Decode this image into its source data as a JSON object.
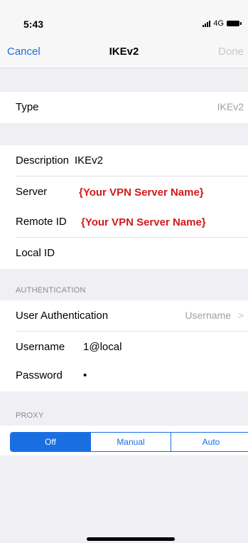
{
  "status": {
    "time": "5:43",
    "network": "4G"
  },
  "nav": {
    "cancel": "Cancel",
    "title": "IKEv2",
    "done": "Done"
  },
  "type_row": {
    "label": "Type",
    "value": "IKEv2"
  },
  "fields": {
    "description": {
      "label": "Description",
      "value": "IKEv2"
    },
    "server": {
      "label": "Server",
      "value": "{Your VPN Server Name}"
    },
    "remote_id": {
      "label": "Remote ID",
      "value": "{Your VPN Server Name}"
    },
    "local_id": {
      "label": "Local ID",
      "value": ""
    }
  },
  "authentication": {
    "header": "AUTHENTICATION",
    "user_auth": {
      "label": "User Authentication",
      "value": "Username"
    },
    "username": {
      "label": "Username",
      "value": "1@local"
    },
    "password": {
      "label": "Password",
      "value": "•"
    }
  },
  "proxy": {
    "header": "PROXY",
    "options": [
      "Off",
      "Manual",
      "Auto"
    ],
    "selected": "Off"
  },
  "colors": {
    "accent": "#1a6fe0",
    "annotation": "#d21a1a"
  }
}
